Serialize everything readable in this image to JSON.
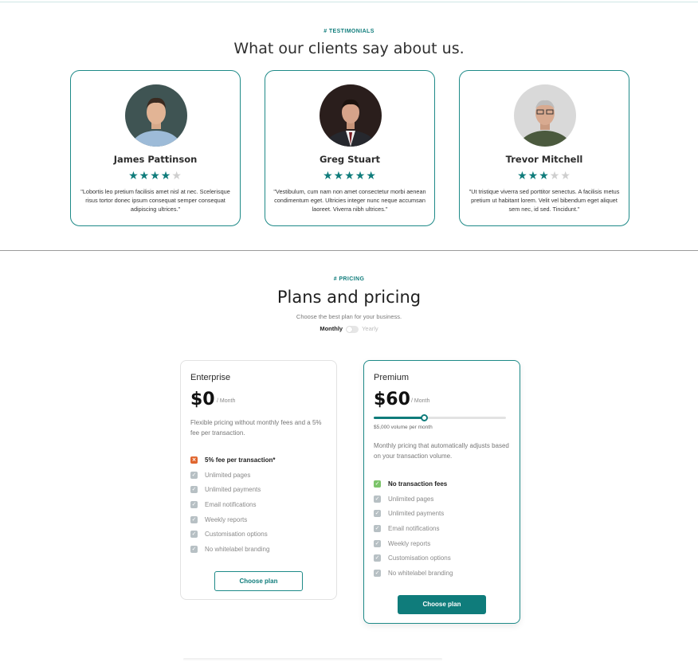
{
  "testimonials": {
    "eyebrow": "# TESTIMONIALS",
    "title": "What our clients say about us.",
    "cards": [
      {
        "name": "James Pattinson",
        "rating": 4,
        "max_rating": 5,
        "quote": "\"Lobortis leo pretium facilisis amet nisl at nec. Scelerisque risus tortor donec ipsum consequat semper consequat adipiscing ultrices.\""
      },
      {
        "name": "Greg Stuart",
        "rating": 5,
        "max_rating": 5,
        "quote": "\"Vestibulum, cum nam non amet consectetur morbi aenean condimentum eget. Ultricies integer nunc neque accumsan laoreet. Viverra nibh ultrices.\""
      },
      {
        "name": "Trevor Mitchell",
        "rating": 3,
        "max_rating": 5,
        "quote": "\"Ut tristique viverra sed porttitor senectus. A facilisis metus pretium ut habitant lorem. Velit vel bibendum eget aliquet sem nec, id sed. Tincidunt.\""
      }
    ]
  },
  "pricing": {
    "eyebrow": "# PRICING",
    "title": "Plans and pricing",
    "subtitle": "Choose the best plan for your business.",
    "billing": {
      "monthly": "Monthly",
      "yearly": "Yearly",
      "selected": "Monthly"
    },
    "plans": [
      {
        "name": "Enterprise",
        "price": "$0",
        "period": "/ Month",
        "description": "Flexible pricing without monthly fees and a 5% fee per transaction.",
        "highlight": "5% fee per transaction*",
        "features": [
          "Unlimited pages",
          "Unlimited payments",
          "Email notifications",
          "Weekly reports",
          "Customisation options",
          "No whitelabel branding"
        ],
        "cta": "Choose plan"
      },
      {
        "name": "Premium",
        "price": "$60",
        "period": "/ Month",
        "slider_fraction": 0.38,
        "volume_label": "$5,000 volume per month",
        "description": "Monthly pricing that automatically adjusts based on your transaction volume.",
        "highlight": "No transaction fees",
        "features": [
          "Unlimited pages",
          "Unlimited payments",
          "Email notifications",
          "Weekly reports",
          "Customisation options",
          "No whitelabel branding"
        ],
        "cta": "Choose plan"
      }
    ]
  },
  "colors": {
    "accent": "#0f7c7b",
    "warn": "#e0662f",
    "ok": "#7cc46b"
  }
}
